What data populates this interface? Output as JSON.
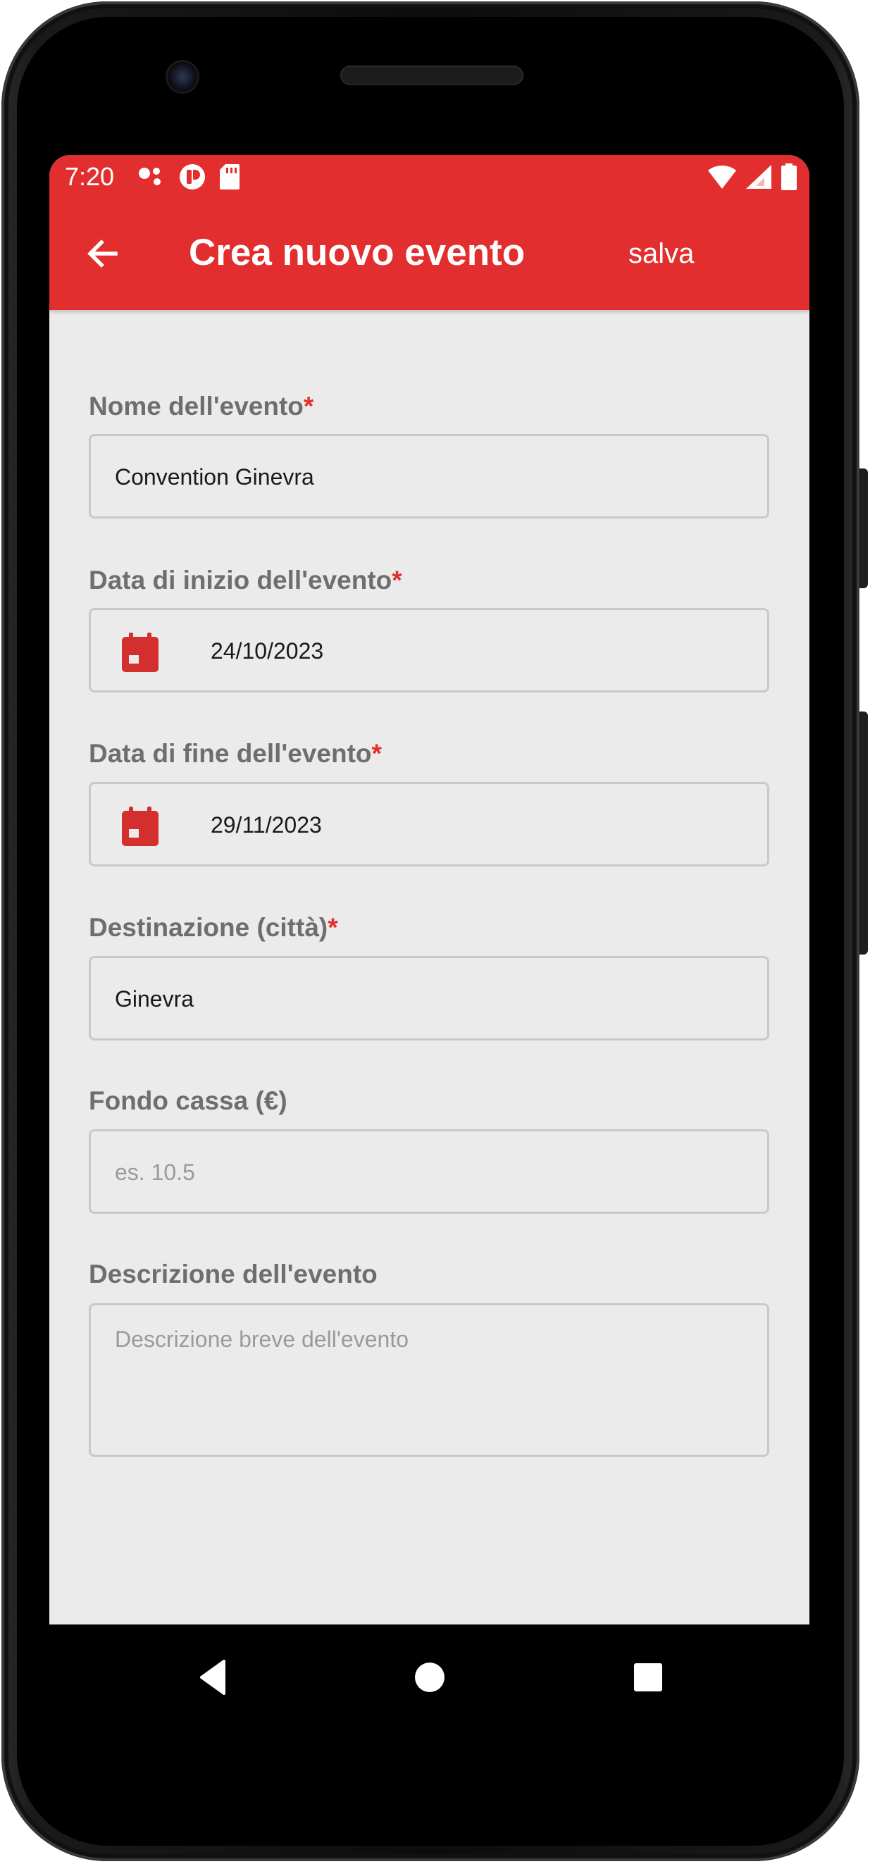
{
  "status_bar": {
    "time": "7:20"
  },
  "toolbar": {
    "title": "Crea nuovo evento",
    "save_label": "salva",
    "back_icon": "arrow-left-icon"
  },
  "form": {
    "required_marker": "*",
    "name": {
      "label": "Nome dell'evento",
      "value": "Convention Ginevra"
    },
    "start_date": {
      "label": "Data di inizio dell'evento",
      "value": "24/10/2023",
      "icon": "calendar-icon"
    },
    "end_date": {
      "label": "Data di fine dell'evento",
      "value": "29/11/2023",
      "icon": "calendar-icon"
    },
    "destination": {
      "label": "Destinazione (città)",
      "value": "Ginevra"
    },
    "fund": {
      "label": "Fondo cassa (€)",
      "placeholder": "es. 10.5"
    },
    "description": {
      "label": "Descrizione dell'evento",
      "placeholder": "Descrizione breve dell'evento"
    }
  },
  "colors": {
    "accent": "#e22e2e",
    "background": "#ebebeb",
    "label": "#6e6e6e"
  }
}
